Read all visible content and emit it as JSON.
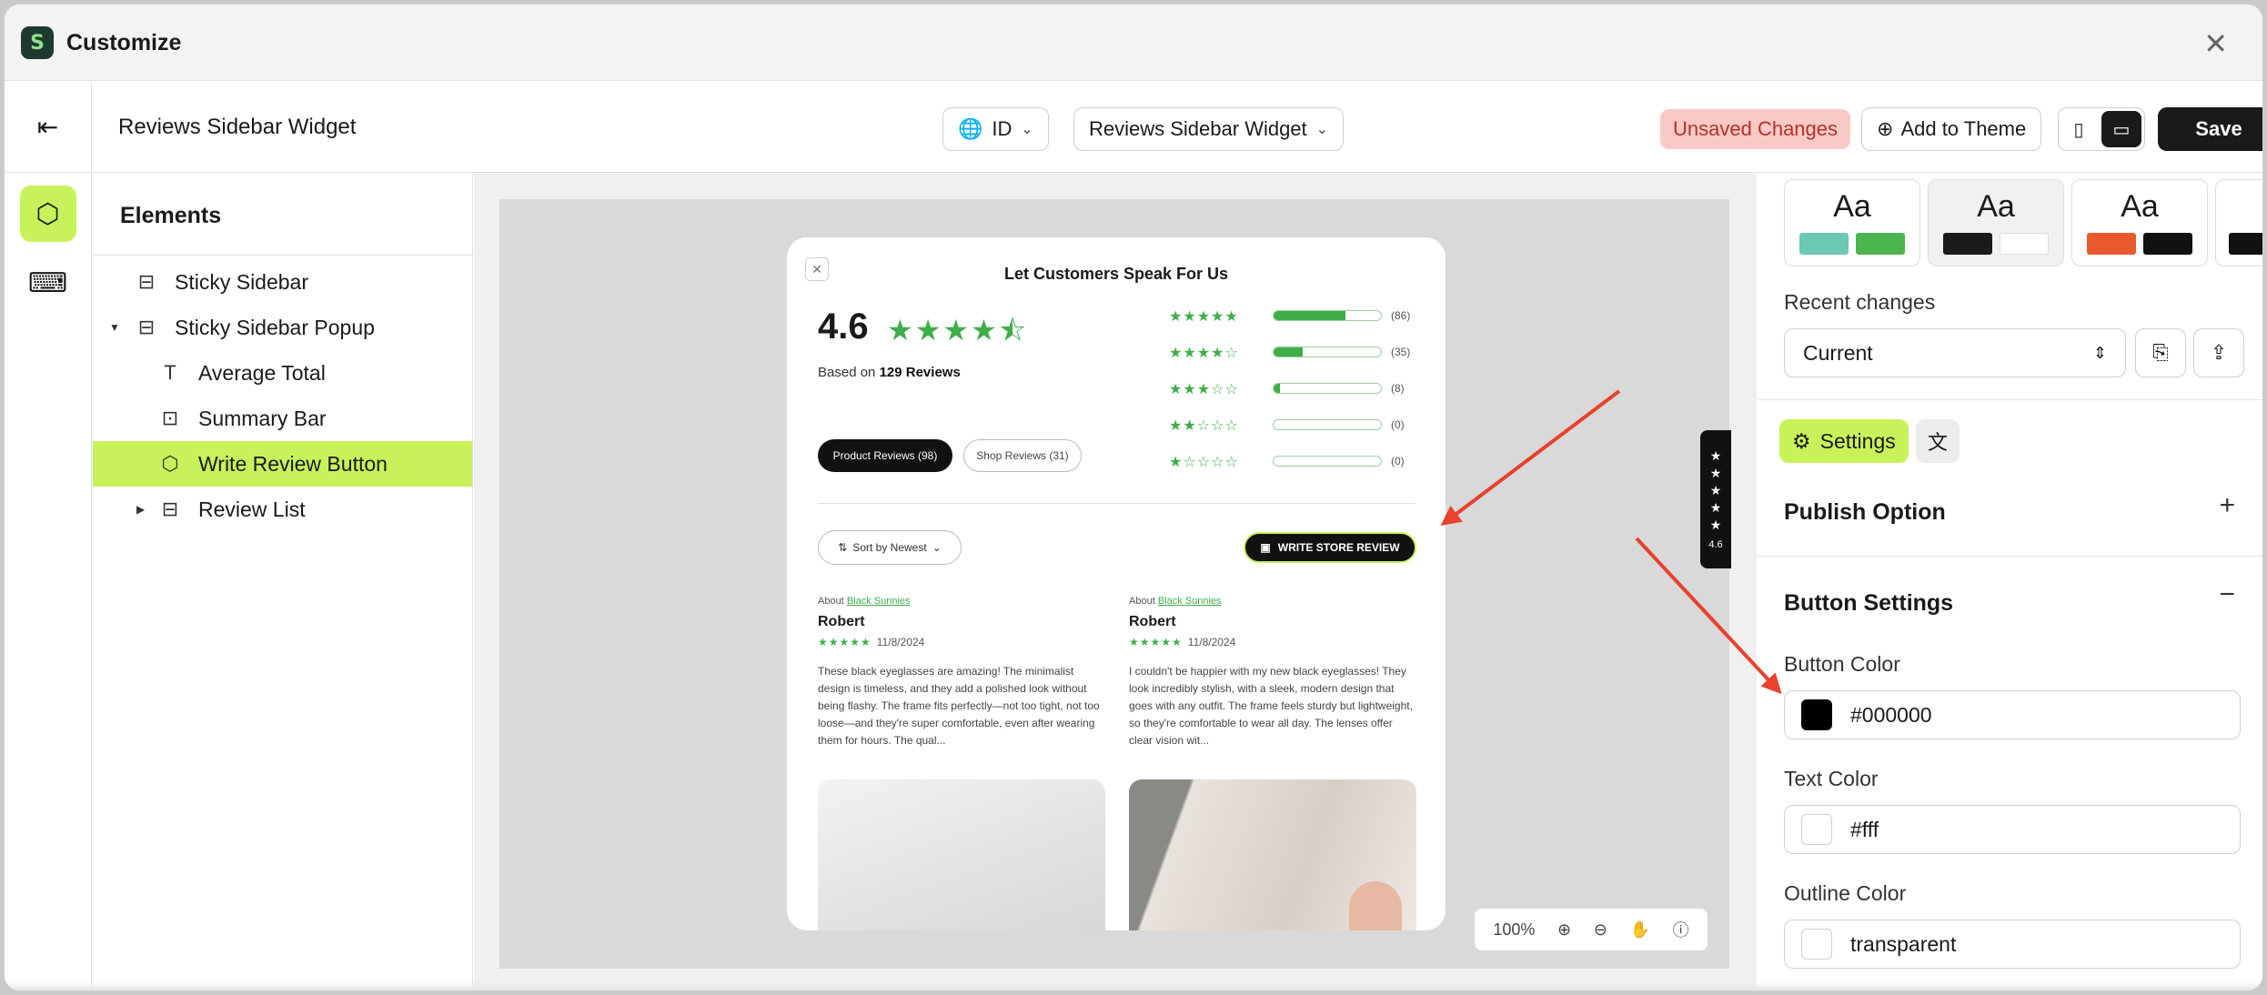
{
  "window": {
    "title": "Customize",
    "logo_letter": "S"
  },
  "topbar": {
    "page_name": "Reviews Sidebar Widget",
    "language": "ID",
    "page_select": "Reviews Sidebar Widget",
    "unsaved": "Unsaved Changes",
    "add_to_theme": "Add to Theme",
    "save": "Save"
  },
  "elements": {
    "title": "Elements",
    "items": [
      {
        "label": "Sticky Sidebar",
        "icon": "sidebar-icon"
      },
      {
        "label": "Sticky Sidebar Popup",
        "icon": "popup-icon"
      },
      {
        "label": "Average Total",
        "icon": "text-icon"
      },
      {
        "label": "Summary Bar",
        "icon": "bar-icon"
      },
      {
        "label": "Write Review Button",
        "icon": "cube-icon"
      },
      {
        "label": "Review List",
        "icon": "list-icon"
      }
    ]
  },
  "preview": {
    "title": "Let Customers Speak For Us",
    "average": "4.6",
    "stars": "★★★★⯪",
    "based_on_prefix": "Based on",
    "based_on_count": "129 Reviews",
    "distribution": [
      {
        "stars": "★★★★★",
        "count": "(86)",
        "fill": 0.67
      },
      {
        "stars": "★★★★☆",
        "count": "(35)",
        "fill": 0.27
      },
      {
        "stars": "★★★☆☆",
        "count": "(8)",
        "fill": 0.06
      },
      {
        "stars": "★★☆☆☆",
        "count": "(0)",
        "fill": 0
      },
      {
        "stars": "★☆☆☆☆",
        "count": "(0)",
        "fill": 0
      }
    ],
    "tab_product": "Product Reviews (98)",
    "tab_shop": "Shop Reviews (31)",
    "sort_label": "Sort by Newest",
    "write_button": "WRITE STORE REVIEW",
    "reviews": [
      {
        "about": "About",
        "product": "Black Sunnies",
        "name": "Robert",
        "stars": "★★★★★",
        "date": "11/8/2024",
        "text": "These black eyeglasses are amazing! The minimalist design is timeless, and they add a polished look without being flashy. The frame fits perfectly—not too tight, not too loose—and they're super comfortable, even after wearing them for hours. The qual..."
      },
      {
        "about": "About",
        "product": "Black Sunnies",
        "name": "Robert",
        "stars": "★★★★★",
        "date": "11/8/2024",
        "text": "I couldn't be happier with my new black eyeglasses! They look incredibly stylish, with a sleek, modern design that goes with any outfit. The frame feels sturdy but lightweight, so they're comfortable to wear all day. The lenses offer clear vision wit..."
      }
    ],
    "side_tab_rating": "4.6",
    "zoom": "100%"
  },
  "panel": {
    "theme_sample": "Aa",
    "themes": [
      {
        "c1": "#6cc7b4",
        "c2": "#4cb54f"
      },
      {
        "c1": "#1a1a1a",
        "c2": "#ffffff"
      },
      {
        "c1": "#e85a2c",
        "c2": "#111111"
      }
    ],
    "recent_changes_label": "Recent changes",
    "recent_changes_value": "Current",
    "settings_tab": "Settings",
    "publish_option": "Publish Option",
    "button_settings": "Button Settings",
    "button_color_label": "Button Color",
    "button_color_value": "#000000",
    "text_color_label": "Text Color",
    "text_color_value": "#fff",
    "outline_color_label": "Outline Color",
    "outline_color_value": "transparent"
  },
  "colors": {
    "accent": "#c8f25a",
    "star": "#3fae4a",
    "annotation": "#e8412c"
  }
}
